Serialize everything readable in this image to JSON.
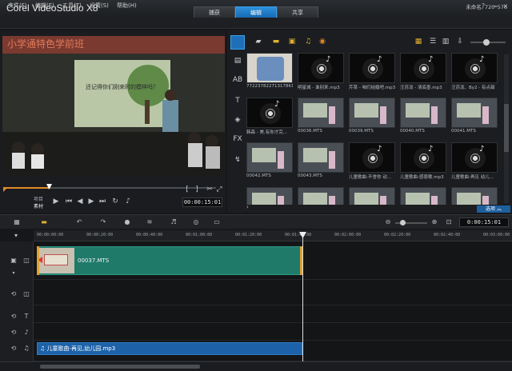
{
  "app": {
    "title": "Corel VideoStudio X8"
  },
  "steps": [
    {
      "label": "捕获"
    },
    {
      "label": "编辑"
    },
    {
      "label": "共享"
    }
  ],
  "window_controls": {
    "help": "?",
    "minimize": "-",
    "close": "×"
  },
  "menu": [
    {
      "label": "文件(F)"
    },
    {
      "label": "编辑(E)"
    },
    {
      "label": "工具(T)"
    },
    {
      "label": "设置(S)"
    },
    {
      "label": "帮助(H)"
    }
  ],
  "project_info": "未命名, 720*576",
  "player": {
    "timecode": "00:00:15:01",
    "mode_labels": {
      "project": "项目",
      "clip": "素材"
    },
    "banner_text": "小学通特色学前班",
    "board_text": "还记得你们刚来时的模样吗？",
    "trim_left": "[",
    "trim_right": "]"
  },
  "library": {
    "items": [
      {
        "caption": "772237822713178614...",
        "kind": "photo"
      },
      {
        "caption": "明星城 - 谁别来.mp3",
        "kind": "audio"
      },
      {
        "caption": "芹菜 - 咱们结婚吧.mp3",
        "kind": "audio"
      },
      {
        "caption": "汪苏泷 - 清底墨.mp3",
        "kind": "audio"
      },
      {
        "caption": "汪苏泷、By2 - 有点甜",
        "kind": "audio"
      },
      {
        "caption": "韩森 - 美,有你才完...",
        "kind": "audio"
      },
      {
        "caption": "00036.MTS",
        "kind": "video"
      },
      {
        "caption": "00039.MTS",
        "kind": "video"
      },
      {
        "caption": "00040.MTS",
        "kind": "video"
      },
      {
        "caption": "00041.MTS",
        "kind": "video"
      },
      {
        "caption": "00042.MTS",
        "kind": "video"
      },
      {
        "caption": "00043.MTS",
        "kind": "video"
      },
      {
        "caption": "儿童歌曲-不舍你 动...",
        "kind": "audio"
      },
      {
        "caption": "儿童歌曲-感恩歌.mp3",
        "kind": "audio"
      },
      {
        "caption": "儿童歌曲-再见 幼儿...",
        "kind": "audio"
      },
      {
        "caption": "",
        "kind": "video"
      },
      {
        "caption": "",
        "kind": "video"
      },
      {
        "caption": "",
        "kind": "video"
      },
      {
        "caption": "",
        "kind": "video"
      },
      {
        "caption": "",
        "kind": "video"
      }
    ],
    "options_label": "选项"
  },
  "timeline": {
    "timecode": "0:00:15:01",
    "ruler": [
      "00:00:00:00",
      "00:00:20:00",
      "00:00:40:00",
      "00:01:00:00",
      "00:01:20:00",
      "00:01:40:00",
      "00:02:00:00",
      "00:02:20:00",
      "00:02:40:00",
      "00:03:00:00"
    ],
    "video_clip": "00037.MTS",
    "audio_clip": "儿童歌曲-再见,幼儿园.mp3"
  },
  "colors": {
    "accent": "#1d74c8",
    "video_clip": "#1f7a6a",
    "audio_clip": "#1d62a8"
  }
}
